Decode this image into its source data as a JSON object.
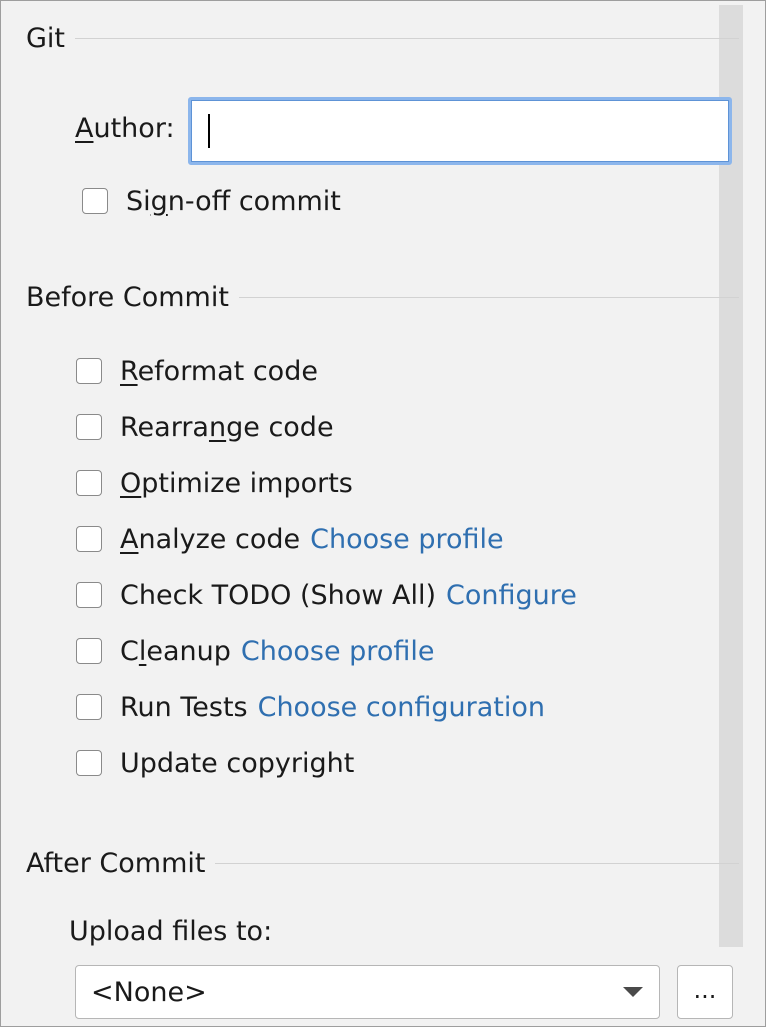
{
  "git": {
    "title": "Git",
    "author": {
      "label_u": "A",
      "label_rest": "uthor:",
      "value": ""
    },
    "signoff": {
      "pre": "Si",
      "u": "g",
      "post": "n-off commit"
    }
  },
  "before_commit": {
    "title": "Before Commit",
    "reformat": {
      "pre": "",
      "u": "R",
      "post": "eformat code"
    },
    "rearrange": {
      "pre": "Rearra",
      "u": "n",
      "post": "ge code"
    },
    "optimize": {
      "pre": "",
      "u": "O",
      "post": "ptimize imports"
    },
    "analyze": {
      "pre": "",
      "u": "A",
      "post": "nalyze code",
      "link": "Choose profile"
    },
    "todo": {
      "text": "Check TODO (Show All)",
      "link": "Configure"
    },
    "cleanup": {
      "pre": "C",
      "u": "l",
      "post": "eanup",
      "link": "Choose profile"
    },
    "run_tests": {
      "text": "Run Tests",
      "link": "Choose configuration"
    },
    "update_copyright": {
      "text": "Update copyright"
    }
  },
  "after_commit": {
    "title": "After Commit",
    "upload_label": "Upload files to:",
    "upload_selected": "<None>",
    "browse_label": "..."
  },
  "colors": {
    "background": "#f2f2f2",
    "link": "#2f6fb0",
    "focus_border": "#8cb6ec"
  }
}
